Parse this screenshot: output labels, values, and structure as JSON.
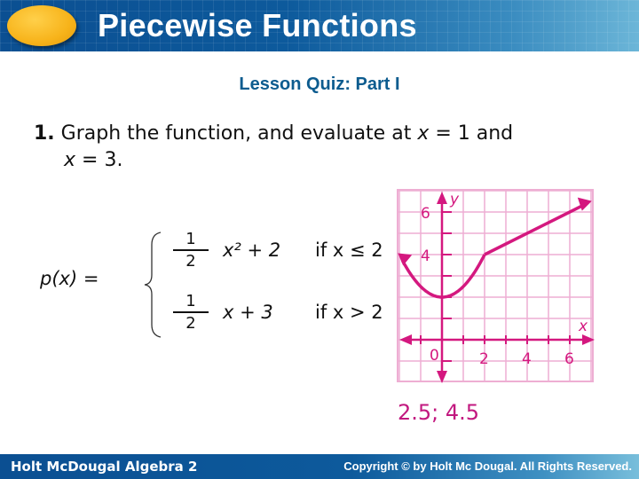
{
  "header": {
    "title": "Piecewise Functions",
    "logo": "orange-oval-logo"
  },
  "subtitle": "Lesson Quiz: Part I",
  "question": {
    "number": "1.",
    "text_part1": "Graph the function, and evaluate at ",
    "var1": "x",
    "text_part2": " = 1 and",
    "var2": "x",
    "text_part3": " = 3."
  },
  "formula": {
    "lhs": "p(x) =",
    "pieces": [
      {
        "numerator": "1",
        "denominator": "2",
        "expression": "x² + 2",
        "condition": "if x ≤ 2"
      },
      {
        "numerator": "1",
        "denominator": "2",
        "expression": "x + 3",
        "condition": "if x > 2"
      }
    ]
  },
  "graph": {
    "x_label": "x",
    "y_label": "y",
    "x_ticks": [
      "0",
      "2",
      "4",
      "6"
    ],
    "y_ticks": [
      "4",
      "6"
    ],
    "x_range": [
      -2,
      7
    ],
    "y_range": [
      -2,
      7
    ],
    "color": "#d4187f",
    "grid_color": "#eeaed3"
  },
  "answer": "2.5; 4.5",
  "footer": {
    "left": "Holt McDougal Algebra 2",
    "right": "Copyright © by Holt Mc Dougal. All Rights Reserved."
  }
}
